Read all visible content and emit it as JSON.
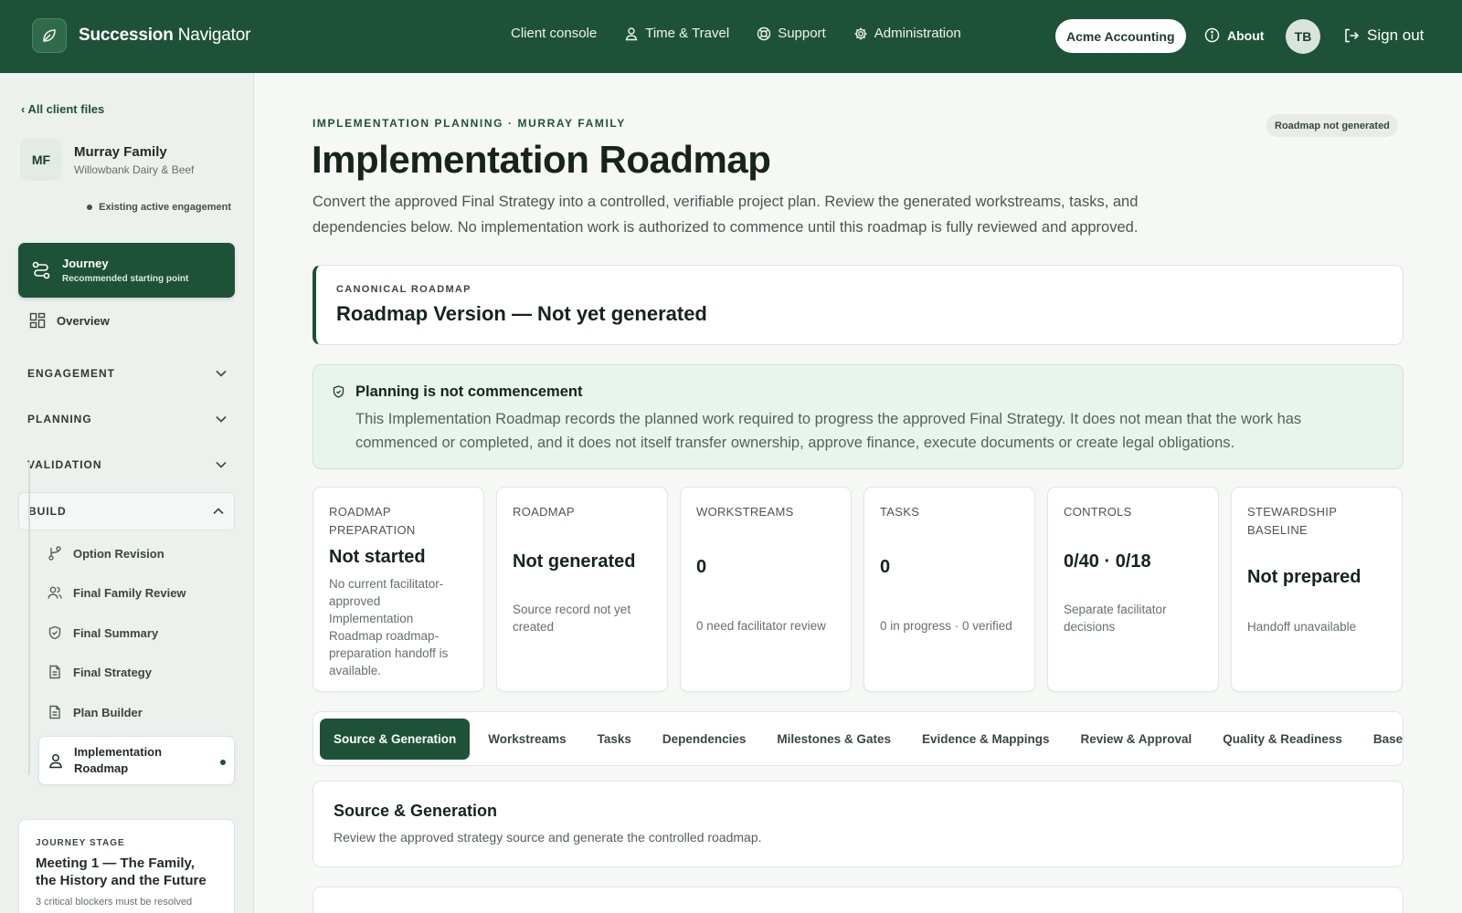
{
  "app": {
    "brand_bold": "Succession",
    "brand_light": "Navigator"
  },
  "nav": {
    "client_console": "Client console",
    "time_travel": "Time & Travel",
    "support": "Support",
    "administration": "Administration",
    "client_pill": "Acme Accounting",
    "about": "About",
    "user_initials": "TB",
    "sign_out": "Sign out"
  },
  "sidebar": {
    "back_link": "‹ All client files",
    "client_initials": "MF",
    "client_name": "Murray Family",
    "client_sub": "Willowbank Dairy & Beef",
    "engagement_status": "Existing active engagement",
    "journey_title": "Journey",
    "journey_sub": "Recommended starting point",
    "overview": "Overview",
    "sections": [
      "ENGAGEMENT",
      "PLANNING",
      "VALIDATION",
      "BUILD"
    ],
    "build_items": [
      "Option Revision",
      "Final Family Review",
      "Final Summary",
      "Final Strategy",
      "Plan Builder"
    ],
    "active_item": "Implementation Roadmap",
    "stage_label": "JOURNEY STAGE",
    "stage_title": "Meeting 1 — The Family, the History and the Future",
    "stage_note": "3 critical blockers must be resolved"
  },
  "main": {
    "eyebrow": "IMPLEMENTATION PLANNING · MURRAY FAMILY",
    "status_pill": "Roadmap not generated",
    "title": "Implementation Roadmap",
    "description": "Convert the approved Final Strategy into a controlled, verifiable project plan. Review the generated workstreams, tasks, and dependencies below. No implementation work is authorized to commence until this roadmap is fully reviewed and approved.",
    "canon_label": "CANONICAL ROADMAP",
    "canon_title": "Roadmap Version — Not yet generated",
    "notice_title": "Planning is not commencement",
    "notice_body": "This Implementation Roadmap records the planned work required to progress the approved Final Strategy. It does not mean that the work has commenced or completed, and it does not itself transfer ownership, approve finance, execute documents or create legal obligations."
  },
  "stats": [
    {
      "label": "ROADMAP PREPARATION",
      "value": "Not started",
      "note": "No current facilitator-approved Implementation Roadmap roadmap-preparation handoff is available."
    },
    {
      "label": "ROADMAP",
      "value": "Not generated",
      "note": "Source record not yet created"
    },
    {
      "label": "WORKSTREAMS",
      "value": "0",
      "note": "0 need facilitator review"
    },
    {
      "label": "TASKS",
      "value": "0",
      "note": "0 in progress · 0 verified"
    },
    {
      "label": "CONTROLS",
      "value": "0/40 · 0/18",
      "note": "Separate facilitator decisions"
    },
    {
      "label": "STEWARDSHIP BASELINE",
      "value": "Not prepared",
      "note": "Handoff unavailable"
    }
  ],
  "tabs": [
    "Source & Generation",
    "Workstreams",
    "Tasks",
    "Dependencies",
    "Milestones & Gates",
    "Evidence & Mappings",
    "Review & Approval",
    "Quality & Readiness",
    "Baseline"
  ],
  "section": {
    "title": "Source & Generation",
    "description": "Review the approved strategy source and generate the controlled roadmap."
  }
}
